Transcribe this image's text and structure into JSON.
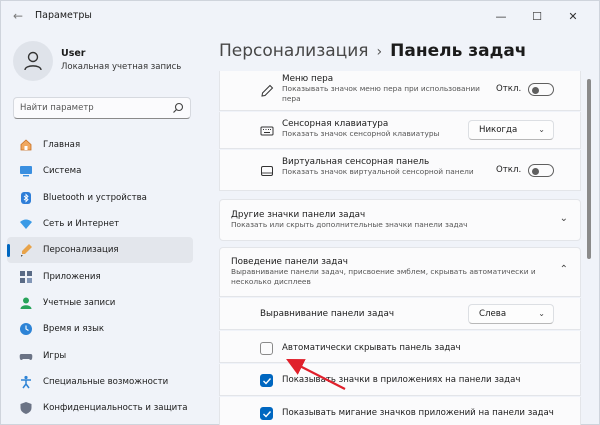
{
  "window": {
    "title": "Параметры",
    "back_glyph": "←",
    "minimize_glyph": "—",
    "maximize_glyph": "☐",
    "close_glyph": "✕"
  },
  "user": {
    "name": "User",
    "account_type": "Локальная учетная запись"
  },
  "search": {
    "placeholder": "Найти параметр"
  },
  "nav": [
    {
      "label": "Главная",
      "icon": "home-icon",
      "active": false
    },
    {
      "label": "Система",
      "icon": "system-icon",
      "active": false
    },
    {
      "label": "Bluetooth и устройства",
      "icon": "bluetooth-icon",
      "active": false
    },
    {
      "label": "Сеть и Интернет",
      "icon": "network-icon",
      "active": false
    },
    {
      "label": "Персонализация",
      "icon": "personalization-icon",
      "active": true
    },
    {
      "label": "Приложения",
      "icon": "apps-icon",
      "active": false
    },
    {
      "label": "Учетные записи",
      "icon": "accounts-icon",
      "active": false
    },
    {
      "label": "Время и язык",
      "icon": "time-language-icon",
      "active": false
    },
    {
      "label": "Игры",
      "icon": "gaming-icon",
      "active": false
    },
    {
      "label": "Специальные возможности",
      "icon": "accessibility-icon",
      "active": false
    },
    {
      "label": "Конфиденциальность и защита",
      "icon": "privacy-icon",
      "active": false
    }
  ],
  "breadcrumb": {
    "parent": "Персонализация",
    "separator": "›",
    "current": "Панель задач"
  },
  "settings": {
    "pen_menu": {
      "title": "Меню пера",
      "desc": "Показывать значок меню пера при использовании пера",
      "state_label": "Откл."
    },
    "touch_keyboard": {
      "title": "Сенсорная клавиатура",
      "desc": "Показать значок сенсорной клавиатуры",
      "dropdown_value": "Никогда"
    },
    "virtual_touchpad": {
      "title": "Виртуальная сенсорная панель",
      "desc": "Показать значок виртуальной сенсорной панели",
      "state_label": "Откл."
    },
    "other_icons": {
      "title": "Другие значки панели задач",
      "desc": "Показать или скрыть дополнительные значки панели задач"
    },
    "behavior": {
      "title": "Поведение панели задач",
      "desc": "Выравнивание панели задач, присвоение эмблем, скрывать автоматически и несколько дисплеев",
      "alignment_label": "Выравнивание панели задач",
      "alignment_value": "Слева",
      "options": [
        {
          "label": "Автоматически скрывать панель задач",
          "checked": false
        },
        {
          "label": "Показывать значки в приложениях на панели задач",
          "checked": true
        },
        {
          "label": "Показывать мигание значков приложений на панели задач",
          "checked": true
        }
      ]
    }
  },
  "colors": {
    "accent": "#0067c0",
    "annotation_arrow": "#e0202b"
  }
}
